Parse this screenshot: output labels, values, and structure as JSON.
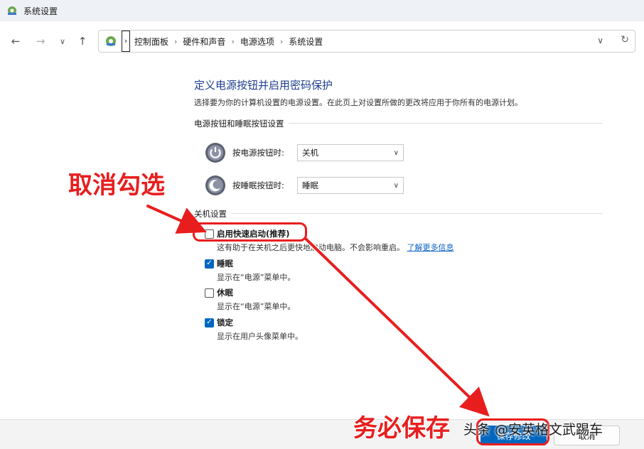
{
  "window": {
    "title": "系统设置"
  },
  "nav": {
    "back_icon": "arrow-left-icon",
    "forward_icon": "arrow-right-icon",
    "recent_icon": "chevron-down-icon",
    "up_icon": "arrow-up-icon",
    "breadcrumbs": [
      "控制面板",
      "硬件和声音",
      "电源选项",
      "系统设置"
    ]
  },
  "page": {
    "heading": "定义电源按钮并启用密码保护",
    "description": "选择要为你的计算机设置的电源设置。在此页上对设置所做的更改将应用于你所有的电源计划。"
  },
  "power_buttons": {
    "group_label": "电源按钮和睡眠按钮设置",
    "power_button": {
      "label": "按电源按钮时:",
      "value": "关机"
    },
    "sleep_button": {
      "label": "按睡眠按钮时:",
      "value": "睡眠"
    }
  },
  "shutdown_settings": {
    "group_label": "关机设置",
    "items": [
      {
        "label": "启用快速启动(推荐)",
        "checked": false,
        "desc": "这有助于在关机之后更快地启动电脑。不会影响重启。",
        "link": "了解更多信息"
      },
      {
        "label": "睡眠",
        "checked": true,
        "desc": "显示在“电源”菜单中。"
      },
      {
        "label": "休眠",
        "checked": false,
        "desc": "显示在“电源”菜单中。"
      },
      {
        "label": "锁定",
        "checked": true,
        "desc": "显示在用户头像菜单中。"
      }
    ]
  },
  "annotations": {
    "uncheck": "取消勾选",
    "save": "务必保存",
    "color": "#e81e1e"
  },
  "footer": {
    "save_label": "保存修改",
    "cancel_label": "取消"
  },
  "watermark": "头条 @安英格文武踢车"
}
